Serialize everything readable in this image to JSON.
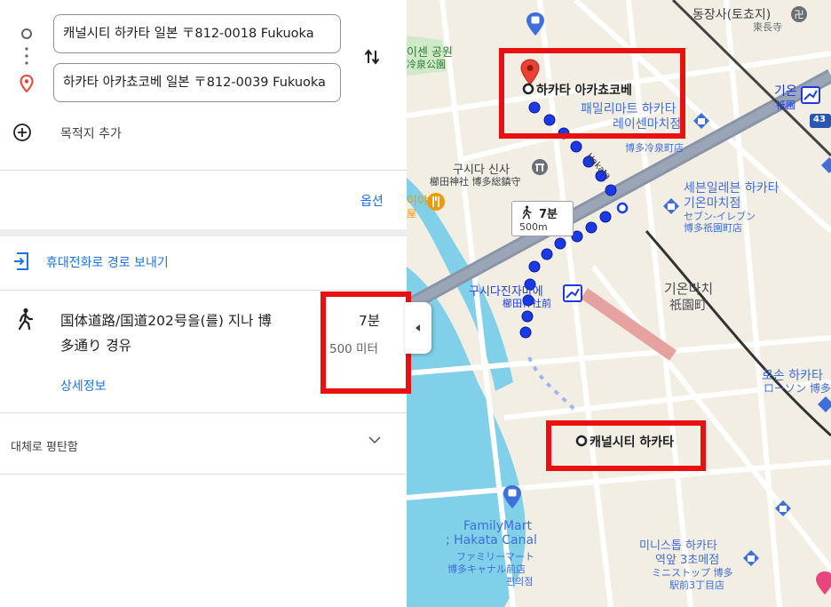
{
  "directions": {
    "origin_value": "캐널시티 하카타 일본 〒812-0018 Fukuoka",
    "destination_value": "하카타 아카쵸코베 일본 〒812-0039 Fukuoka",
    "add_destination_label": "목적지 추가",
    "options_label": "옵션"
  },
  "send_to_phone_label": "휴대전화로 경로 보내기",
  "route": {
    "description_line1": "国体道路/国道202号을(를) 지나 博",
    "description_line2": "多通り 경유",
    "duration": "7분",
    "distance": "500 미터",
    "details_label": "상세정보"
  },
  "terrain": {
    "label": "대체로 평탄함"
  },
  "map": {
    "walk_badge": {
      "time": "7분",
      "distance": "500m"
    },
    "destination_label": "하카타 아카쵸코베",
    "origin_label": "캐널시티 하카타",
    "road_label": "Hakata",
    "poi_labels": {
      "temple": "동장사(토쵸지)",
      "temple_jp": "東長寺",
      "park": "이센 공원",
      "park_jp": "冷泉公園",
      "familymart_top1": "패밀리마트 하카타",
      "familymart_top2": "레이센마치점",
      "familymart_top_jp": "博多冷泉町店",
      "shrine": "구시다 신사",
      "shrine_jp": "櫛田神社 博多総鎮守",
      "seven1": "세븐일레븐 하카타",
      "seven2": "기온마치점",
      "seven_jp1": "セブン-イレブン",
      "seven_jp2": "博多祇園町店",
      "gion_station": "기온",
      "gion_station_jp": "祇園",
      "kushida_station": "구시다진자마에",
      "kushida_station_jp": "櫛田神社前",
      "gionmachi": "기온마치",
      "gionmachi_jp": "祇園町",
      "lawson": "로손 하카타",
      "lawson_jp": "ローソン 博多",
      "restaurant": "이야",
      "restaurant_jp": "屋",
      "familymart_bottom1": "FamilyMart",
      "familymart_bottom2": "; Hakata Canal",
      "familymart_bottom_jp1": "ファミリーマート",
      "familymart_bottom_jp2": "博多キャナル前店",
      "familymart_bottom_jp3": "편의점",
      "ministop1": "미니스톱 하카타",
      "ministop2": "역앞 3초메점",
      "ministop_jp1": "ミニストップ 博多",
      "ministop_jp2": "駅前3丁目店",
      "route_shield": "43"
    }
  },
  "colors": {
    "link_blue": "#1a73e8",
    "route_blue": "#1a3ae8",
    "highlight_red": "#e8110f",
    "pin_red": "#ea4335"
  }
}
